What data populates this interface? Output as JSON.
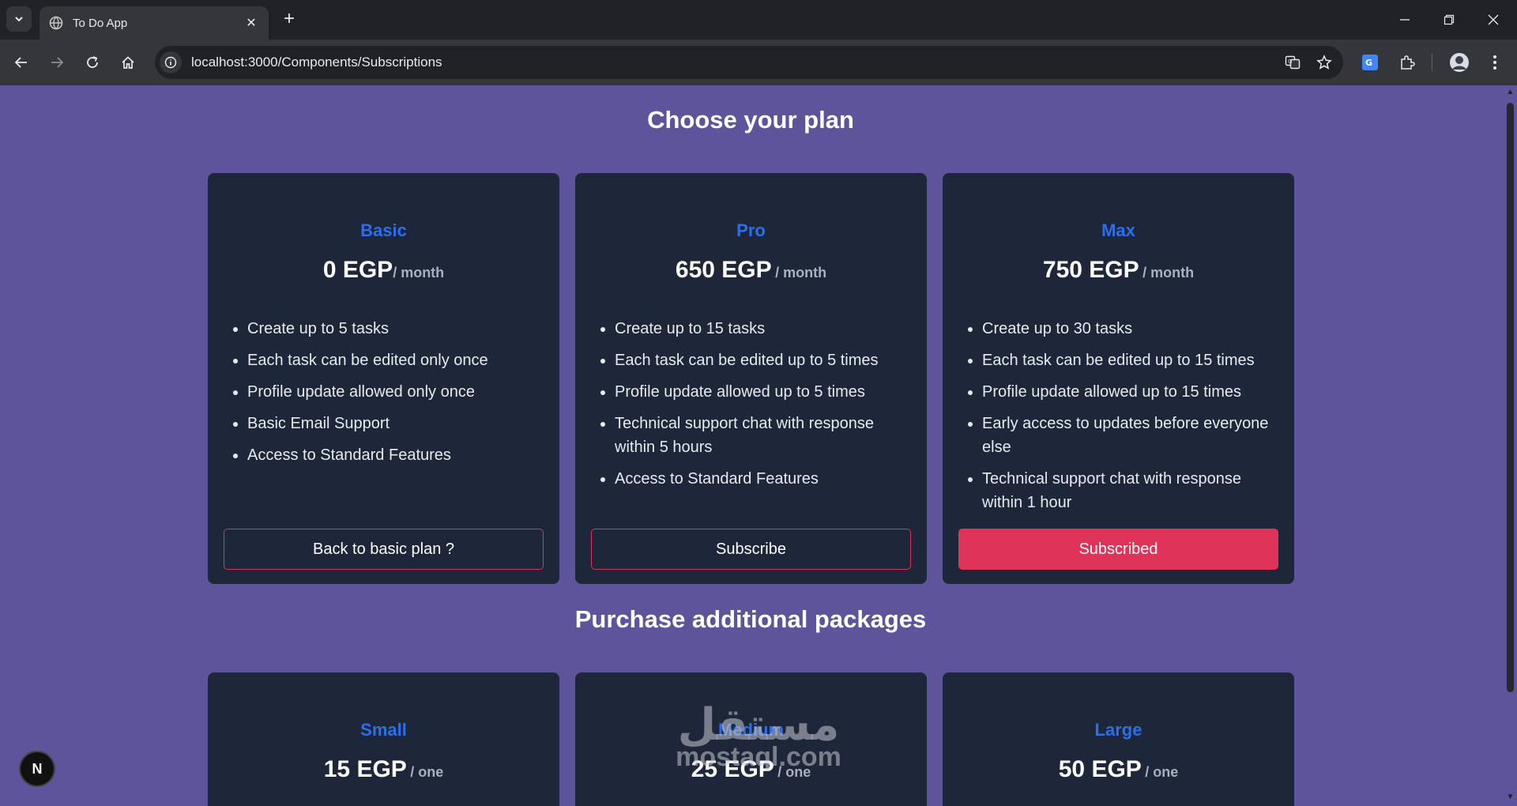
{
  "browser": {
    "tab_title": "To Do App",
    "url": "localhost:3000/Components/Subscriptions"
  },
  "plans_section": {
    "title": "Choose your plan",
    "plans": [
      {
        "name": "Basic",
        "price": "0 EGP",
        "period": "/ month",
        "features": [
          "Create up to 5 tasks",
          "Each task can be edited only once",
          "Profile update allowed only once",
          "Basic Email Support",
          "Access to Standard Features"
        ],
        "button": "Back to basic plan ?"
      },
      {
        "name": "Pro",
        "price": "650 EGP",
        "period": "/ month",
        "features": [
          "Create up to 15 tasks",
          "Each task can be edited up to 5 times",
          "Profile update allowed up to 5 times",
          "Technical support chat with response within 5 hours",
          "Access to Standard Features"
        ],
        "button": "Subscribe"
      },
      {
        "name": "Max",
        "price": "750 EGP",
        "period": "/ month",
        "features": [
          "Create up to 30 tasks",
          "Each task can be edited up to 15 times",
          "Profile update allowed up to 15 times",
          "Early access to updates before everyone else",
          "Technical support chat with response within 1 hour"
        ],
        "button": "Subscribed"
      }
    ]
  },
  "packages_section": {
    "title": "Purchase additional packages",
    "packages": [
      {
        "name": "Small",
        "price": "15 EGP",
        "period": "/ one"
      },
      {
        "name": "Medium",
        "price": "25 EGP",
        "period": "/ one"
      },
      {
        "name": "Large",
        "price": "50 EGP",
        "period": "/ one"
      }
    ]
  },
  "dev_badge": "N",
  "watermark": {
    "arabic": "مستقل",
    "latin": "mostaql.com"
  }
}
